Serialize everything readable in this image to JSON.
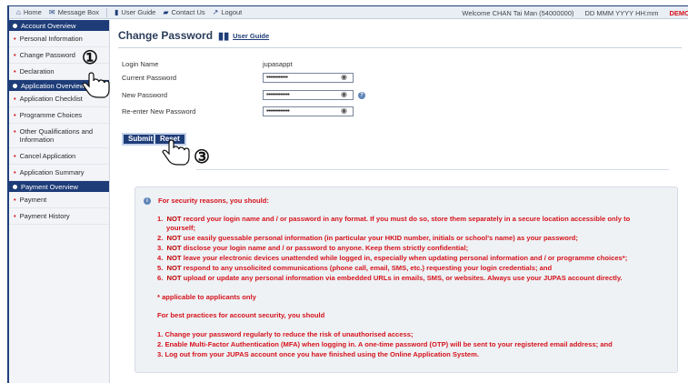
{
  "topbar": {
    "home": "Home",
    "message_box": "Message Box",
    "user_guide": "User Guide",
    "contact_us": "Contact Us",
    "logout": "Logout",
    "welcome": "Welcome CHAN Tai Man (54000000)",
    "datetime": "DD MMM YYYY HH:mm",
    "demo": "DEMO"
  },
  "sidebar": {
    "account_header": "Account Overview",
    "account_items": [
      "Personal Information",
      "Change Password",
      "Declaration"
    ],
    "application_header": "Application Overview",
    "application_items": [
      "Application Checklist",
      "Programme Choices",
      "Other Qualifications and Information",
      "Cancel Application",
      "Application Summary"
    ],
    "payment_header": "Payment Overview",
    "payment_items": [
      "Payment",
      "Payment History"
    ]
  },
  "main": {
    "title": "Change Password",
    "user_guide": "User Guide",
    "fields": {
      "login_name_label": "Login Name",
      "login_name_value": "jupasappt",
      "current_password_label": "Current Password",
      "current_password_value": "••••••••••••",
      "new_password_label": "New Password",
      "new_password_value": "•••••••••••••",
      "reenter_password_label": "Re-enter New Password",
      "reenter_password_value": "•••••••••••••"
    },
    "submit": "Submit",
    "reset": "Reset"
  },
  "annotations": {
    "step1": "①",
    "step3": "③"
  },
  "notice": {
    "heading": "For security reasons, you should:",
    "item1_num": "1.",
    "item1_em": "NOT",
    "item1_a": "record your login name and / or password in any format. If you must do so, store them separately in a secure location accessible only to",
    "item1_b": "yourself;",
    "item2_num": "2.",
    "item2_em": "NOT",
    "item2": "use easily guessable personal information (in particular your HKID number, initials or school's name) as your password;",
    "item3_num": "3.",
    "item3_em": "NOT",
    "item3": "disclose your login name and / or password to anyone. Keep them strictly confidential;",
    "item4_num": "4.",
    "item4_em": "NOT",
    "item4": "leave your electronic devices unattended while logged in, especially when updating personal information and / or programme choices*;",
    "item5_num": "5.",
    "item5_em": "NOT",
    "item5": "respond to any unsolicited communications (phone call, email, SMS, etc.) requesting your login credentials; and",
    "item6_num": "6.",
    "item6_em": "NOT",
    "item6": "upload or update any personal information via embedded URLs in emails, SMS, or websites. Always use your JUPAS account directly.",
    "footnote": "* applicable to applicants only",
    "best_heading": "For best practices for account security, you should",
    "best1": "1. Change your password regularly to reduce the risk of unauthorised access;",
    "best2": "2. Enable Multi-Factor Authentication (MFA) when logging in. A one-time password (OTP) will be sent to your registered email address; and",
    "best3": "3. Log out from your JUPAS account once you have finished using the Online Application System."
  },
  "colors": {
    "nav_blue": "#1e3c78",
    "alert_red": "#d6131c"
  }
}
